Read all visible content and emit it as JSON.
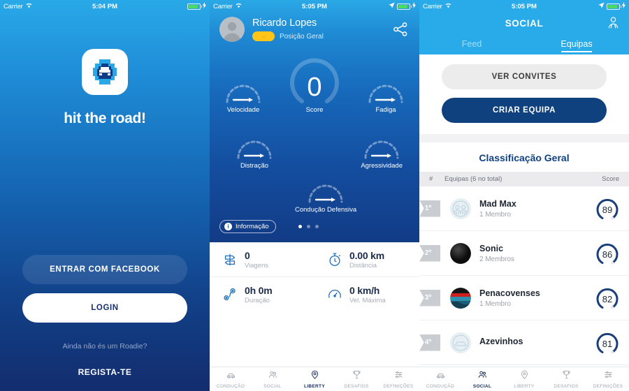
{
  "panels": {
    "login": {
      "status": {
        "carrier": "Carrier",
        "time": "5:04 PM",
        "wifi_icon": "wifi-icon",
        "battery_icon": "battery-icon",
        "charging_icon": "charging-bolt-icon"
      },
      "logo_icon": "car-app-logo-icon",
      "tagline": "hit the road!",
      "facebook_button": "ENTRAR COM FACEBOOK",
      "login_button": "LOGIN",
      "hint": "Ainda não és um Roadie?",
      "register_link": "REGISTA-TE",
      "colors": {
        "top": "#29a9e8",
        "bottom": "#132d6e",
        "login_text": "#16306b"
      }
    },
    "dashboard": {
      "status": {
        "carrier": "Carrier",
        "time": "5:05 PM",
        "wifi_icon": "wifi-icon",
        "location_icon": "location-arrow-icon",
        "battery_icon": "battery-icon",
        "charging_icon": "charging-bolt-icon"
      },
      "user_name": "Ricardo Lopes",
      "position_badge": "--",
      "position_label": "Posição Geral",
      "share_icon": "share-icon",
      "avatar_icon": "user-avatar-icon",
      "score_value": "0",
      "score_label": "Score",
      "gauges": [
        {
          "label": "Velocidade",
          "icon": "gauge-icon"
        },
        {
          "label": "Fadiga",
          "icon": "gauge-icon"
        },
        {
          "label": "Distração",
          "icon": "gauge-icon"
        },
        {
          "label": "Agressividade",
          "icon": "gauge-icon"
        },
        {
          "label": "Condução Defensiva",
          "icon": "gauge-icon"
        }
      ],
      "info_chip": "Informação",
      "info_icon": "info-icon",
      "page_dots": 3,
      "active_dot": 0,
      "stats": [
        {
          "icon": "signpost-icon",
          "value": "0",
          "caption": "Viagens"
        },
        {
          "icon": "stopwatch-icon",
          "value": "0.00 km",
          "caption": "Distância"
        },
        {
          "icon": "route-pin-icon",
          "value": "0h 0m",
          "caption": "Duração"
        },
        {
          "icon": "speedometer-icon",
          "value": "0 km/h",
          "caption": "Vel. Máxima"
        }
      ],
      "tabs": [
        {
          "label": "CONDUÇÃO",
          "icon": "car-icon",
          "active": false
        },
        {
          "label": "SOCIAL",
          "icon": "people-icon",
          "active": false
        },
        {
          "label": "LIBERTY",
          "icon": "pin-icon",
          "active": true
        },
        {
          "label": "DESAFIOS",
          "icon": "trophy-icon",
          "active": false
        },
        {
          "label": "DEFINIÇÕES",
          "icon": "sliders-icon",
          "active": false
        }
      ],
      "colors": {
        "top": "#2aa8e6",
        "bottom": "#123b85",
        "badge": "#ffc419"
      }
    },
    "social": {
      "status": {
        "carrier": "Carrier",
        "time": "5:05 PM",
        "wifi_icon": "wifi-icon",
        "location_icon": "location-arrow-icon",
        "battery_icon": "battery-icon",
        "charging_icon": "charging-bolt-icon"
      },
      "title": "SOCIAL",
      "people_icon": "people-outline-icon",
      "tabs": [
        {
          "label": "Feed",
          "active": false
        },
        {
          "label": "Equipas",
          "active": true
        }
      ],
      "invites_button": "VER CONVITES",
      "create_button": "CRIAR EQUIPA",
      "ranking_title": "Classificação Geral",
      "columns": {
        "rank": "#",
        "teams": "Equipas (6 no total)",
        "score": "Score"
      },
      "rows": [
        {
          "rank": "1º",
          "name": "Mad Max",
          "members": "1 Membro",
          "score": "89",
          "avatar": "team-avatar-madmax"
        },
        {
          "rank": "2º",
          "name": "Sonic",
          "members": "2 Membros",
          "score": "86",
          "avatar": "team-avatar-sonic"
        },
        {
          "rank": "3º",
          "name": "Penacovenses",
          "members": "1 Membro",
          "score": "82",
          "avatar": "team-avatar-penacovenses"
        },
        {
          "rank": "4º",
          "name": "Azevinhos",
          "members": "",
          "score": "81",
          "avatar": "team-avatar-azevinhos"
        }
      ],
      "tabs_bottom": [
        {
          "label": "CONDUÇÃO",
          "icon": "car-icon",
          "active": false
        },
        {
          "label": "SOCIAL",
          "icon": "people-icon",
          "active": true
        },
        {
          "label": "LIBERTY",
          "icon": "pin-icon",
          "active": false
        },
        {
          "label": "DESAFIOS",
          "icon": "trophy-icon",
          "active": false
        },
        {
          "label": "DEFINIÇÕES",
          "icon": "sliders-icon",
          "active": false
        }
      ],
      "colors": {
        "nav": "#29ABE9",
        "accent": "#10417f",
        "score_arc": "#1b3f7a"
      }
    }
  }
}
